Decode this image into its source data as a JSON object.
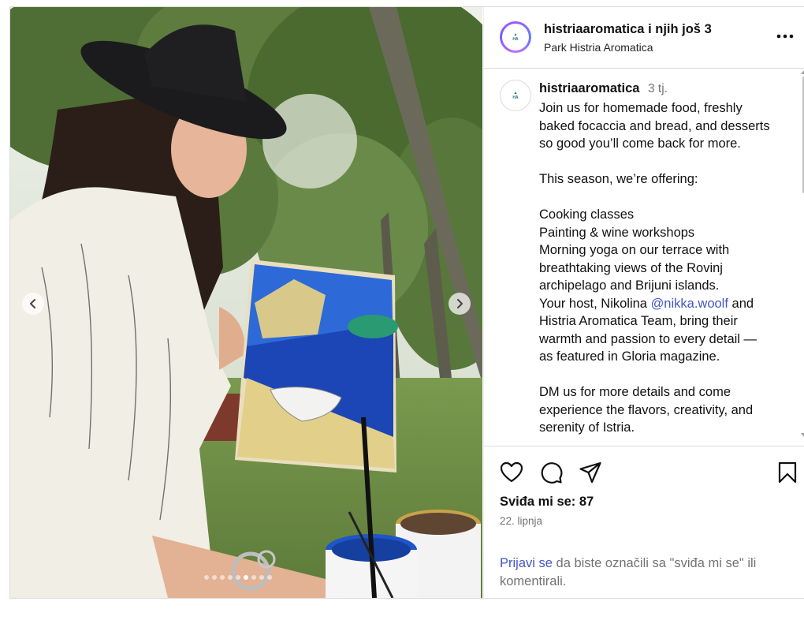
{
  "post": {
    "header": {
      "username": "histriaaromatica",
      "collab_suffix": " i njih još 3",
      "location": "Park Histria Aromatica",
      "avatar_text": "HISTRIA AROMATICA"
    },
    "caption": {
      "username": "histriaaromatica",
      "time": "3 tj.",
      "lines_1": [
        "Join us for homemade food, freshly",
        "baked focaccia and bread, and desserts",
        "so good you’ll come back for more."
      ],
      "line_2": "This season, we’re offering:",
      "lines_3": [
        "Cooking classes",
        "Painting & wine workshops",
        "Morning yoga on our terrace with",
        "breathtaking views of the Rovinj",
        "archipelago and Brijuni islands."
      ],
      "host_prefix": "Your host, Nikolina ",
      "host_mention": "@nikka.woolf",
      "host_suffix": "  and",
      "lines_4": [
        "Histria Aromatica Team, bring their",
        "warmth and passion to every detail —",
        "as featured in Gloria magazine."
      ],
      "lines_5": [
        "DM us for more details and come",
        "experience the flavors, creativity, and",
        "serenity of Istria."
      ]
    },
    "likes": "Sviđa mi se: 87",
    "date": "22. lipnja",
    "login": {
      "link": "Prijavi se",
      "rest": " da biste označili sa \"sviđa mi se\" ili komentirali."
    },
    "carousel": {
      "total_slides": 9,
      "active_index": 5
    }
  },
  "icons": {
    "like": "heart-icon",
    "comment": "comment-icon",
    "share": "send-icon",
    "save": "bookmark-icon",
    "more": "more-horizontal-icon",
    "prev": "chevron-left-icon",
    "next": "chevron-right-icon"
  },
  "colors": {
    "link": "#4455c8",
    "muted": "#737373",
    "border": "#dbdbdb"
  }
}
